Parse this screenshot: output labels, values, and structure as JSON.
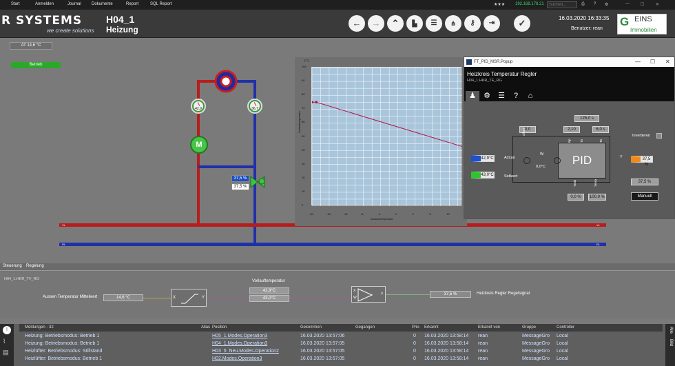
{
  "menu": {
    "items": [
      "Start",
      "Anmelden",
      "Journal",
      "Dokumente",
      "Report",
      "SQL Report"
    ],
    "stars": "★★★",
    "ip": "192.168.178.21",
    "search_placeholder": "Suchen...",
    "icons": [
      "printer-icon",
      "help-icon",
      "gear-icon"
    ]
  },
  "header": {
    "logo": "R SYSTEMS",
    "logo_sub": "we create solutions",
    "page_id": "H04_1",
    "page_title": "Heizung",
    "buttons": [
      "arrow-left-icon",
      "arrow-right-icon",
      "up-icon",
      "factory-icon",
      "server-icon",
      "network-icon",
      "key-icon",
      "exit-icon",
      "check-icon"
    ],
    "datetime": "16.03.2020  16:33:35",
    "user_label": "Benutzer: rean",
    "brand_g": "G",
    "brand_word": "EINS",
    "brand_sub": "Immobilien"
  },
  "process": {
    "at_value": "AT 14,6 °C",
    "status": "Betrieb",
    "gauge_left": "42,9",
    "gauge_right": "36,7",
    "motor": "M",
    "valve_setpoint": "37,5 %",
    "valve_actual": "37,5 %",
    "pipe_label_vl": "VL",
    "pipe_label_rl": "RL"
  },
  "chart_data": {
    "type": "line",
    "title": "",
    "ylabel_unit": "[°C]",
    "ylabel": "Vorlauftemperatur",
    "xlabel": "Aussentemperatur",
    "xlim": [
      -20,
      15
    ],
    "ylim": [
      0,
      100
    ],
    "x_ticks": [
      -20,
      -16,
      -12,
      -8,
      -4,
      0,
      4,
      8,
      12
    ],
    "y_ticks": [
      0,
      10,
      20,
      30,
      40,
      50,
      60,
      70,
      80,
      90,
      100
    ],
    "series": [
      {
        "x": [
          -20,
          -19,
          15
        ],
        "y": [
          75,
          75,
          43
        ]
      }
    ]
  },
  "popup": {
    "title": "FT_PID_MSR.Popup",
    "heading": "Heizkreis Temperatur Regler",
    "sub": "H04_1.HKR_TE_RG",
    "tabs": [
      "user-icon",
      "gear-icon",
      "database-icon",
      "help-icon",
      "tag-icon"
    ],
    "kd": "125,0 s",
    "offset": "0,0",
    "kp": "2,10",
    "tn": "6,0 s",
    "invert_label": "Invertieren",
    "actual_label": "Actual",
    "actual_value": "42,9°C",
    "setpoint_label": "Sollwert",
    "setpoint_value": "43,0°C",
    "w_label": "W",
    "w_value": "0,0°C",
    "pid": "PID",
    "y_label": "Y",
    "y_value": "37,5 %",
    "ymin": "0,0 %",
    "ymax": "100,0 %",
    "manual_value": "37,5 %",
    "manual_button": "Manuell",
    "offset_tag": "offset",
    "kp_tag": "Kp",
    "tn_tag": "Tn",
    "tv_tag": "Tv",
    "ymin_tag": "Ymin",
    "ymax_tag": "Ymax"
  },
  "control": {
    "tabs": [
      "Steuerung",
      "Regelung"
    ],
    "id": "H04_1.HKR_TV_RG",
    "aussen_label": "Aussen Temperatur Mittelwert",
    "aussen_value": "14,6 °C",
    "vorlauf_label": "Vorlauftemperatur",
    "vorlauf_1": "42,9°C",
    "vorlauf_2": "43,0°C",
    "block_x": "X",
    "block_y": "Y",
    "pid_x": "X",
    "pid_w": "W",
    "pid_y": "Y",
    "regler_value": "37,5 %",
    "regler_label": "Heizkreis Regler Regelsignal"
  },
  "messages": {
    "header": [
      "Meldungen - 32",
      "Alias",
      "Position",
      "Gekommen",
      "Gegangen",
      "Prio",
      "Erkannt",
      "Erkannt von",
      "Gruppe",
      "Controller"
    ],
    "rows": [
      [
        "Heizung: Betriebsmodus: Betrieb 1",
        "H05_1.Modes.Operation3",
        "16.03.2020 13:57:06",
        "0",
        "16.03.2020 13:58:14",
        "rean",
        "MessageGro",
        "Local"
      ],
      [
        "Heizung: Betriebsmodus: Betrieb 1",
        "H04_1.Modes.Operation3",
        "16.03.2020 13:57:05",
        "0",
        "16.03.2020 13:58:14",
        "rean",
        "MessageGro",
        "Local"
      ],
      [
        "Heizlüfter: Betriebsmodus: Stillstand",
        "H03_5_Neu.Modes.Operation2",
        "16.03.2020 13:57:05",
        "0",
        "16.03.2020 13:58:14",
        "rean",
        "MessageGro",
        "Local"
      ],
      [
        "Heizlüfter: Betriebsmodus: Betrieb 1",
        "H02.Modes.Operation3",
        "16.03.2020 13:57:05",
        "0",
        "16.03.2020 13:58:14",
        "rean",
        "MessageGro",
        "Local"
      ]
    ],
    "side_tabs": [
      "Alle",
      "Bild"
    ]
  }
}
